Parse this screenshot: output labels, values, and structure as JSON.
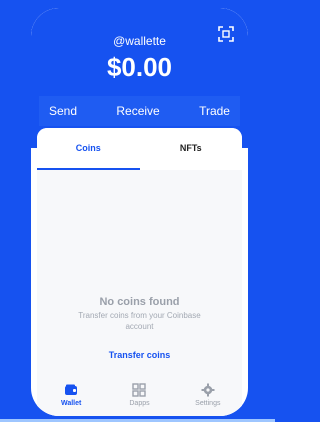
{
  "header": {
    "username": "@wallette",
    "balance": "$0.00",
    "scan_icon": "qr-scan-icon"
  },
  "actions": {
    "send": "Send",
    "receive": "Receive",
    "trade": "Trade"
  },
  "tabs": [
    {
      "label": "Coins",
      "active": true
    },
    {
      "label": "NFTs",
      "active": false
    }
  ],
  "empty_state": {
    "title": "No coins found",
    "subtitle": "Transfer coins from your Coinbase account",
    "link": "Transfer coins"
  },
  "nav": [
    {
      "label": "Wallet",
      "icon": "wallet-icon",
      "active": true
    },
    {
      "label": "Dapps",
      "icon": "grid-icon",
      "active": false
    },
    {
      "label": "Settings",
      "icon": "gear-icon",
      "active": false
    }
  ],
  "colors": {
    "brand": "#1652f0",
    "muted": "#9aa0aa"
  }
}
